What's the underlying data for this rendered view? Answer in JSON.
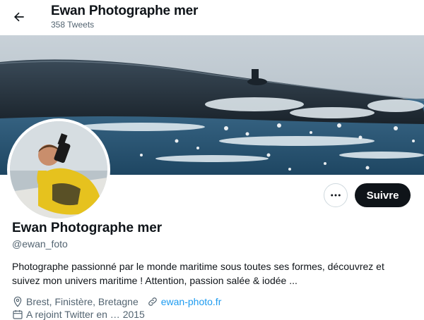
{
  "header": {
    "title": "Ewan Photographe mer",
    "tweet_count": "358 Tweets"
  },
  "profile": {
    "name": "Ewan Photographe mer",
    "handle": "@ewan_foto",
    "bio": "Photographe passionné par le monde maritime sous toutes ses formes, découvrez et suivez mon univers maritime ! Attention, passion salée & iodée ...",
    "location": "Brest, Finistère, Bretagne",
    "website": "ewan-photo.fr",
    "joined": "A rejoint Twitter en … 2015"
  },
  "actions": {
    "more_label": "…",
    "follow_label": "Suivre"
  },
  "icons": {
    "back": "arrow-left-icon",
    "more": "more-horizontal-icon",
    "location": "location-pin-icon",
    "link": "link-icon",
    "calendar": "calendar-icon"
  },
  "colors": {
    "accent": "#1d9bf0",
    "follow_bg": "#0f1419",
    "secondary_text": "#536471"
  }
}
